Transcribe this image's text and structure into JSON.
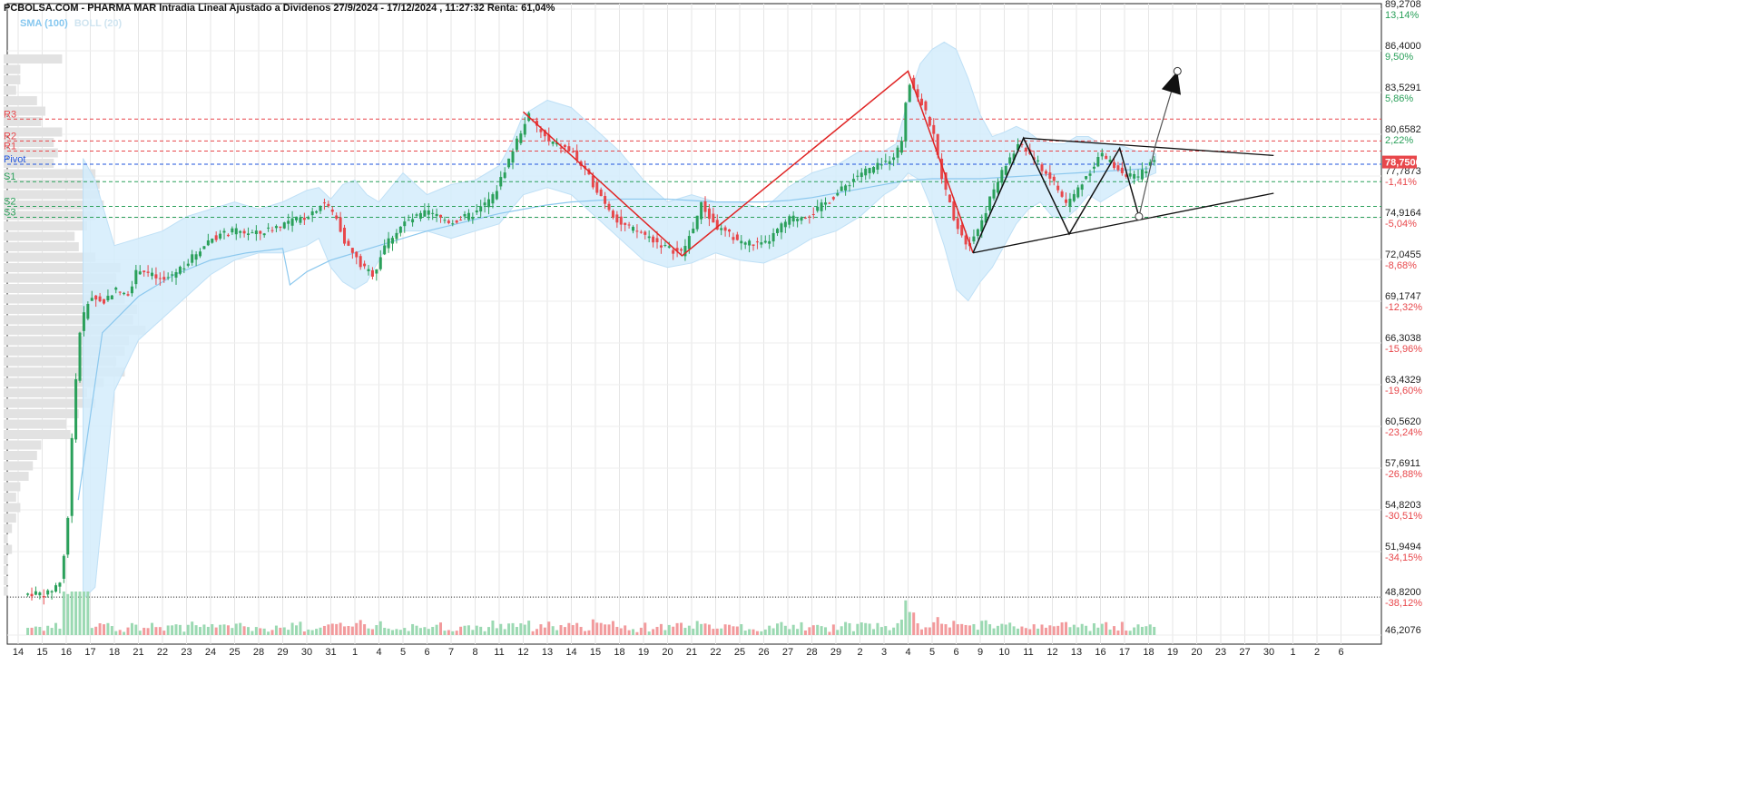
{
  "header": {
    "title": "PCBOLSA.COM - PHARMA MAR Intradia Lineal Ajustado a Dividenos 27/9/2024 - 17/12/2024 , 11:27:32 Renta: 61,04%",
    "legend_sma": "SMA (100)",
    "legend_boll": "BOLL (20)"
  },
  "colors": {
    "up": "#2aa05a",
    "down": "#e8474b",
    "band": "#d4ecfb",
    "sma": "#8cc8ee",
    "pivot": "#2255dd",
    "resistance": "#e8474b",
    "support": "#2aa05a",
    "current": "#e8474b"
  },
  "chart_data": {
    "type": "candlestick",
    "ylim": [
      46.2076,
      89.2708
    ],
    "y_ticks": [
      {
        "value": 89.2708,
        "label": "89,2708",
        "pct": "13,14%",
        "sign": "pos"
      },
      {
        "value": 86.4,
        "label": "86,4000",
        "pct": "9,50%",
        "sign": "pos"
      },
      {
        "value": 83.5291,
        "label": "83,5291",
        "pct": "5,86%",
        "sign": "pos"
      },
      {
        "value": 80.6582,
        "label": "80,6582",
        "pct": "2,22%",
        "sign": "pos"
      },
      {
        "value": 77.7873,
        "label": "77,7873",
        "pct": "-1,41%",
        "sign": "neg"
      },
      {
        "value": 74.9164,
        "label": "74,9164",
        "pct": "-5,04%",
        "sign": "neg"
      },
      {
        "value": 72.0455,
        "label": "72,0455",
        "pct": "-8,68%",
        "sign": "neg"
      },
      {
        "value": 69.1747,
        "label": "69,1747",
        "pct": "-12,32%",
        "sign": "neg"
      },
      {
        "value": 66.3038,
        "label": "66,3038",
        "pct": "-15,96%",
        "sign": "neg"
      },
      {
        "value": 63.4329,
        "label": "63,4329",
        "pct": "-19,60%",
        "sign": "neg"
      },
      {
        "value": 60.562,
        "label": "60,5620",
        "pct": "-23,24%",
        "sign": "neg"
      },
      {
        "value": 57.6911,
        "label": "57,6911",
        "pct": "-26,88%",
        "sign": "neg"
      },
      {
        "value": 54.8203,
        "label": "54,8203",
        "pct": "-30,51%",
        "sign": "neg"
      },
      {
        "value": 51.9494,
        "label": "51,9494",
        "pct": "-34,15%",
        "sign": "neg"
      },
      {
        "value": 48.82,
        "label": "48,8200",
        "pct": "-38,12%",
        "sign": "neg"
      },
      {
        "value": 46.2076,
        "label": "46,2076",
        "pct": "",
        "sign": "neg"
      }
    ],
    "current_price": {
      "value": 78.75,
      "label": "78,7500"
    },
    "reference_level": 48.82,
    "pivot_levels": [
      {
        "name": "R3",
        "value": 81.7,
        "kind": "resistance"
      },
      {
        "name": "R2",
        "value": 80.2,
        "kind": "resistance"
      },
      {
        "name": "R1",
        "value": 79.5,
        "kind": "resistance"
      },
      {
        "name": "Pivot",
        "value": 78.6,
        "kind": "pivot"
      },
      {
        "name": "S1",
        "value": 77.4,
        "kind": "support"
      },
      {
        "name": "S2",
        "value": 75.7,
        "kind": "support"
      },
      {
        "name": "S3",
        "value": 74.95,
        "kind": "support"
      }
    ],
    "x_labels": [
      "14",
      "15",
      "16",
      "17",
      "18",
      "21",
      "22",
      "23",
      "24",
      "25",
      "28",
      "29",
      "30",
      "31",
      "1",
      "4",
      "5",
      "6",
      "7",
      "8",
      "11",
      "12",
      "13",
      "14",
      "15",
      "18",
      "19",
      "20",
      "21",
      "22",
      "25",
      "26",
      "27",
      "28",
      "29",
      "2",
      "3",
      "4",
      "5",
      "6",
      "9",
      "10",
      "11",
      "12",
      "13",
      "16",
      "17",
      "18",
      "19",
      "20",
      "23",
      "27",
      "30",
      "1",
      "2",
      "6"
    ],
    "x_count_total": 56,
    "keypoints": [
      {
        "i": 0,
        "p": 48.9
      },
      {
        "i": 0.6,
        "p": 49.1
      },
      {
        "i": 1.2,
        "p": 49.0
      },
      {
        "i": 1.8,
        "p": 50.0
      },
      {
        "i": 2.1,
        "p": 55.0
      },
      {
        "i": 2.3,
        "p": 62.0
      },
      {
        "i": 2.6,
        "p": 67.5
      },
      {
        "i": 3.0,
        "p": 69.6
      },
      {
        "i": 3.5,
        "p": 69.0
      },
      {
        "i": 4.0,
        "p": 70.0
      },
      {
        "i": 4.5,
        "p": 69.5
      },
      {
        "i": 5.0,
        "p": 71.5
      },
      {
        "i": 6.0,
        "p": 70.5
      },
      {
        "i": 7.0,
        "p": 71.8
      },
      {
        "i": 8.0,
        "p": 73.5
      },
      {
        "i": 9.0,
        "p": 74.0
      },
      {
        "i": 10.0,
        "p": 73.8
      },
      {
        "i": 11.0,
        "p": 74.5
      },
      {
        "i": 12.0,
        "p": 75.0
      },
      {
        "i": 12.7,
        "p": 76.0
      },
      {
        "i": 13.2,
        "p": 75.0
      },
      {
        "i": 13.6,
        "p": 73.2
      },
      {
        "i": 14.3,
        "p": 71.5
      },
      {
        "i": 14.8,
        "p": 71.0
      },
      {
        "i": 15.2,
        "p": 73.0
      },
      {
        "i": 16.0,
        "p": 74.5
      },
      {
        "i": 17.0,
        "p": 75.3
      },
      {
        "i": 18.0,
        "p": 74.6
      },
      {
        "i": 19.0,
        "p": 75.2
      },
      {
        "i": 19.8,
        "p": 76.5
      },
      {
        "i": 20.3,
        "p": 78.5
      },
      {
        "i": 20.8,
        "p": 80.5
      },
      {
        "i": 21.2,
        "p": 82.0
      },
      {
        "i": 22.0,
        "p": 80.2
      },
      {
        "i": 23.0,
        "p": 79.5
      },
      {
        "i": 24.0,
        "p": 77.0
      },
      {
        "i": 25.0,
        "p": 74.5
      },
      {
        "i": 26.0,
        "p": 73.8
      },
      {
        "i": 27.0,
        "p": 72.8
      },
      {
        "i": 27.6,
        "p": 72.5
      },
      {
        "i": 28.0,
        "p": 74.0
      },
      {
        "i": 28.4,
        "p": 75.8
      },
      {
        "i": 29.0,
        "p": 74.3
      },
      {
        "i": 30.0,
        "p": 73.3
      },
      {
        "i": 31.0,
        "p": 73.0
      },
      {
        "i": 32.0,
        "p": 74.8
      },
      {
        "i": 33.0,
        "p": 75.2
      },
      {
        "i": 34.0,
        "p": 76.5
      },
      {
        "i": 35.0,
        "p": 78.0
      },
      {
        "i": 36.0,
        "p": 78.6
      },
      {
        "i": 36.7,
        "p": 79.8
      },
      {
        "i": 37.0,
        "p": 84.5
      },
      {
        "i": 37.5,
        "p": 83.0
      },
      {
        "i": 38.0,
        "p": 81.0
      },
      {
        "i": 38.5,
        "p": 77.0
      },
      {
        "i": 39.0,
        "p": 74.5
      },
      {
        "i": 39.5,
        "p": 73.0
      },
      {
        "i": 40.0,
        "p": 74.5
      },
      {
        "i": 40.6,
        "p": 77.0
      },
      {
        "i": 41.2,
        "p": 79.0
      },
      {
        "i": 41.7,
        "p": 80.0
      },
      {
        "i": 42.2,
        "p": 79.0
      },
      {
        "i": 43.0,
        "p": 77.5
      },
      {
        "i": 43.6,
        "p": 75.8
      },
      {
        "i": 44.3,
        "p": 77.5
      },
      {
        "i": 45.0,
        "p": 79.3
      },
      {
        "i": 45.8,
        "p": 78.2
      },
      {
        "i": 46.5,
        "p": 77.6
      },
      {
        "i": 47.0,
        "p": 78.5
      },
      {
        "i": 47.3,
        "p": 78.75
      }
    ],
    "bollinger": {
      "x": [
        2.7,
        3.2,
        4.0,
        5.0,
        6.0,
        7.0,
        8.0,
        9.0,
        10.0,
        11.0,
        12.0,
        12.5,
        13.0,
        13.5,
        14.0,
        14.5,
        15.0,
        15.5,
        16.0,
        17.0,
        18.0,
        19.0,
        20.0,
        20.5,
        21.0,
        22.0,
        23.0,
        24.0,
        25.0,
        26.0,
        27.0,
        28.0,
        29.0,
        30.0,
        31.0,
        32.0,
        33.0,
        34.0,
        35.0,
        36.0,
        36.5,
        37.0,
        37.5,
        38.0,
        38.5,
        39.0,
        39.5,
        40.0,
        40.5,
        41.0,
        41.5,
        42.0,
        42.5,
        43.0,
        43.5,
        44.0,
        44.5,
        45.0,
        45.5,
        46.0,
        46.5,
        47.0,
        47.3
      ],
      "upper": [
        79.0,
        77.5,
        73.0,
        73.5,
        74.0,
        75.0,
        75.5,
        76.0,
        75.5,
        76.0,
        76.8,
        77.0,
        76.2,
        77.2,
        77.5,
        76.5,
        76.0,
        77.0,
        78.0,
        76.5,
        77.2,
        77.5,
        78.5,
        80.0,
        82.0,
        83.0,
        82.5,
        81.0,
        79.5,
        77.5,
        76.0,
        76.5,
        76.0,
        76.0,
        75.5,
        77.0,
        78.0,
        78.5,
        79.5,
        79.5,
        80.0,
        83.0,
        85.5,
        86.5,
        87.0,
        86.5,
        84.5,
        82.0,
        80.5,
        80.8,
        81.2,
        80.8,
        80.2,
        80.0,
        80.0,
        80.5,
        80.5,
        80.0,
        80.0,
        79.8,
        79.5,
        79.5,
        79.3
      ],
      "lower": [
        48.7,
        49.5,
        63.0,
        66.5,
        68.0,
        69.5,
        71.0,
        72.0,
        72.5,
        72.5,
        73.0,
        73.5,
        71.5,
        70.5,
        70.0,
        70.5,
        72.0,
        73.5,
        74.0,
        74.0,
        73.5,
        74.0,
        74.5,
        75.5,
        76.5,
        77.0,
        76.5,
        75.0,
        73.5,
        72.0,
        71.5,
        71.8,
        72.5,
        72.0,
        71.8,
        72.5,
        73.5,
        74.0,
        75.0,
        76.5,
        77.0,
        78.0,
        77.5,
        75.5,
        73.0,
        70.0,
        69.2,
        70.5,
        71.5,
        73.0,
        74.5,
        75.5,
        76.0,
        75.0,
        74.8,
        75.5,
        76.5,
        76.0,
        76.5,
        77.0,
        77.5,
        77.8,
        78.0
      ]
    },
    "sma": {
      "x": [
        2.5,
        3.5,
        5.0,
        6.5,
        8.0,
        9.5,
        11.0,
        11.3,
        12.0,
        13.0,
        14.0,
        15.0,
        16.0,
        17.0,
        18.0,
        19.0,
        20.0,
        21.0,
        22.0,
        23.0,
        24.0,
        25.0,
        26.0,
        27.0,
        28.0,
        29.0,
        30.0,
        31.0,
        32.0,
        33.0,
        34.0,
        35.0,
        36.0,
        37.0,
        38.0,
        39.0,
        40.0,
        41.0,
        42.0,
        43.0,
        44.0,
        45.0,
        46.0,
        47.0
      ],
      "y": [
        55.5,
        67.0,
        69.5,
        71.0,
        72.0,
        72.5,
        72.8,
        70.3,
        71.2,
        72.0,
        72.5,
        73.0,
        73.5,
        74.0,
        74.4,
        74.8,
        75.2,
        75.5,
        75.8,
        76.0,
        76.1,
        76.2,
        76.2,
        76.2,
        76.1,
        76.0,
        76.0,
        76.0,
        76.1,
        76.3,
        76.6,
        76.9,
        77.2,
        77.5,
        77.6,
        77.6,
        77.6,
        77.7,
        77.8,
        77.9,
        78.0,
        78.1,
        78.2,
        78.3
      ]
    },
    "volume_ylim": [
      0,
      100
    ],
    "volume_profile": [
      14,
      4,
      4,
      3,
      8,
      10,
      9,
      14,
      12,
      13,
      12,
      22,
      23,
      23,
      24,
      22,
      20,
      17,
      18,
      22,
      28,
      27,
      27,
      29,
      32,
      31,
      34,
      30,
      29,
      27,
      29,
      24,
      20,
      22,
      18,
      15,
      16,
      9,
      8,
      7,
      6,
      4,
      3,
      4,
      3,
      2,
      1,
      2,
      1,
      1,
      1,
      1
    ],
    "patterns": {
      "red_zigzag": [
        {
          "i": 21.0,
          "p": 82.2
        },
        {
          "i": 27.6,
          "p": 72.3
        },
        {
          "i": 37.0,
          "p": 85.0
        },
        {
          "i": 39.7,
          "p": 72.5
        }
      ],
      "black_zigzag": [
        {
          "i": 39.7,
          "p": 72.5
        },
        {
          "i": 41.8,
          "p": 80.4
        },
        {
          "i": 43.7,
          "p": 73.8
        },
        {
          "i": 45.8,
          "p": 79.7
        },
        {
          "i": 46.6,
          "p": 75.0
        }
      ],
      "upper_trendline": [
        {
          "i": 41.8,
          "p": 80.4
        },
        {
          "i": 52.2,
          "p": 79.2
        }
      ],
      "lower_trendline": [
        {
          "i": 39.7,
          "p": 72.5
        },
        {
          "i": 52.2,
          "p": 76.6
        }
      ],
      "projection": [
        {
          "i": 46.6,
          "p": 75.0
        },
        {
          "i": 47.3,
          "p": 80.0
        },
        {
          "i": 48.2,
          "p": 85.0
        }
      ],
      "markers": [
        {
          "i": 46.6,
          "p": 75.0
        },
        {
          "i": 48.2,
          "p": 85.0
        }
      ]
    }
  }
}
